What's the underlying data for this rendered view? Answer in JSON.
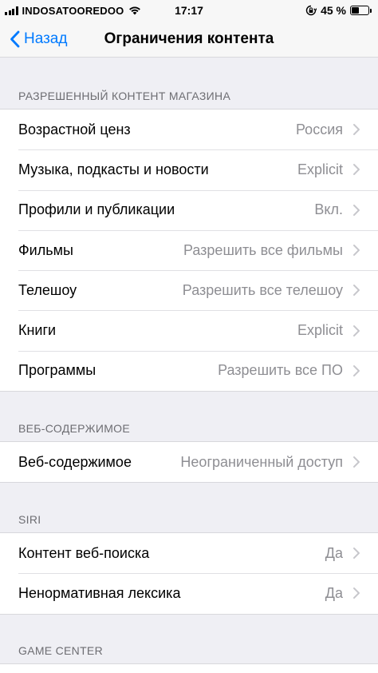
{
  "status_bar": {
    "carrier": "INDOSATOOREDOO",
    "time": "17:17",
    "battery_percent": "45 %",
    "battery_level": 0.45
  },
  "nav": {
    "back_label": "Назад",
    "title": "Ограничения контента"
  },
  "sections": [
    {
      "header": "РАЗРЕШЕННЫЙ КОНТЕНТ МАГАЗИНА",
      "rows": [
        {
          "label": "Возрастной ценз",
          "value": "Россия"
        },
        {
          "label": "Музыка, подкасты и новости",
          "value": "Explicit"
        },
        {
          "label": "Профили и публикации",
          "value": "Вкл."
        },
        {
          "label": "Фильмы",
          "value": "Разрешить все фильмы"
        },
        {
          "label": "Телешоу",
          "value": "Разрешить все телешоу"
        },
        {
          "label": "Книги",
          "value": "Explicit"
        },
        {
          "label": "Программы",
          "value": "Разрешить все ПО"
        }
      ]
    },
    {
      "header": "ВЕБ-СОДЕРЖИМОЕ",
      "rows": [
        {
          "label": "Веб-содержимое",
          "value": "Неограниченный доступ"
        }
      ]
    },
    {
      "header": "SIRI",
      "rows": [
        {
          "label": "Контент веб-поиска",
          "value": "Да"
        },
        {
          "label": "Ненормативная лексика",
          "value": "Да"
        }
      ]
    },
    {
      "header": "GAME CENTER",
      "rows": []
    }
  ],
  "colors": {
    "accent": "#007aff",
    "background": "#efeff4",
    "secondary_text": "#8e8e93",
    "chevron": "#c7c7cc"
  }
}
